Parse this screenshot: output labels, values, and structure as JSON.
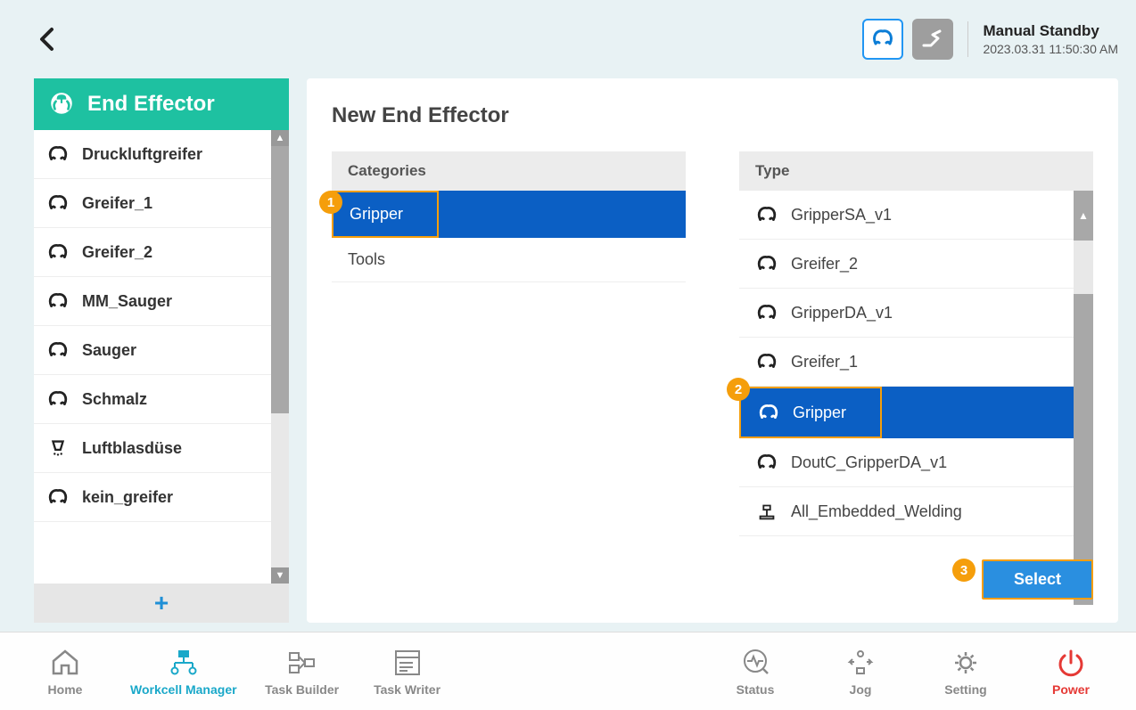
{
  "header": {
    "status_line1": "Manual Standby",
    "status_line2": "2023.03.31 11:50:30 AM"
  },
  "sidebar": {
    "title": "End Effector",
    "items": [
      {
        "label": "Druckluftgreifer",
        "icon": "gripper"
      },
      {
        "label": "Greifer_1",
        "icon": "gripper"
      },
      {
        "label": "Greifer_2",
        "icon": "gripper"
      },
      {
        "label": "MM_Sauger",
        "icon": "gripper"
      },
      {
        "label": "Sauger",
        "icon": "gripper"
      },
      {
        "label": "Schmalz",
        "icon": "gripper"
      },
      {
        "label": "Luftblasdüse",
        "icon": "nozzle"
      },
      {
        "label": "kein_greifer",
        "icon": "gripper"
      }
    ],
    "add_label": "+"
  },
  "main": {
    "title": "New End Effector",
    "categories_header": "Categories",
    "categories": [
      {
        "label": "Gripper",
        "selected": true
      },
      {
        "label": "Tools",
        "selected": false
      }
    ],
    "type_header": "Type",
    "types": [
      {
        "label": "GripperSA_v1",
        "icon": "gripper",
        "selected": false
      },
      {
        "label": "Greifer_2",
        "icon": "gripper",
        "selected": false
      },
      {
        "label": "GripperDA_v1",
        "icon": "gripper",
        "selected": false
      },
      {
        "label": "Greifer_1",
        "icon": "gripper",
        "selected": false
      },
      {
        "label": "Gripper",
        "icon": "gripper",
        "selected": true
      },
      {
        "label": "DoutC_GripperDA_v1",
        "icon": "gripper",
        "selected": false
      },
      {
        "label": "All_Embedded_Welding",
        "icon": "weld",
        "selected": false
      }
    ],
    "select_label": "Select",
    "badges": {
      "b1": "1",
      "b2": "2",
      "b3": "3"
    }
  },
  "footer": {
    "left": [
      {
        "id": "home",
        "label": "Home"
      },
      {
        "id": "workcell",
        "label": "Workcell Manager",
        "active": true
      },
      {
        "id": "taskbuilder",
        "label": "Task Builder"
      },
      {
        "id": "taskwriter",
        "label": "Task Writer"
      }
    ],
    "right": [
      {
        "id": "status",
        "label": "Status"
      },
      {
        "id": "jog",
        "label": "Jog"
      },
      {
        "id": "setting",
        "label": "Setting"
      },
      {
        "id": "power",
        "label": "Power",
        "power": true
      }
    ]
  }
}
